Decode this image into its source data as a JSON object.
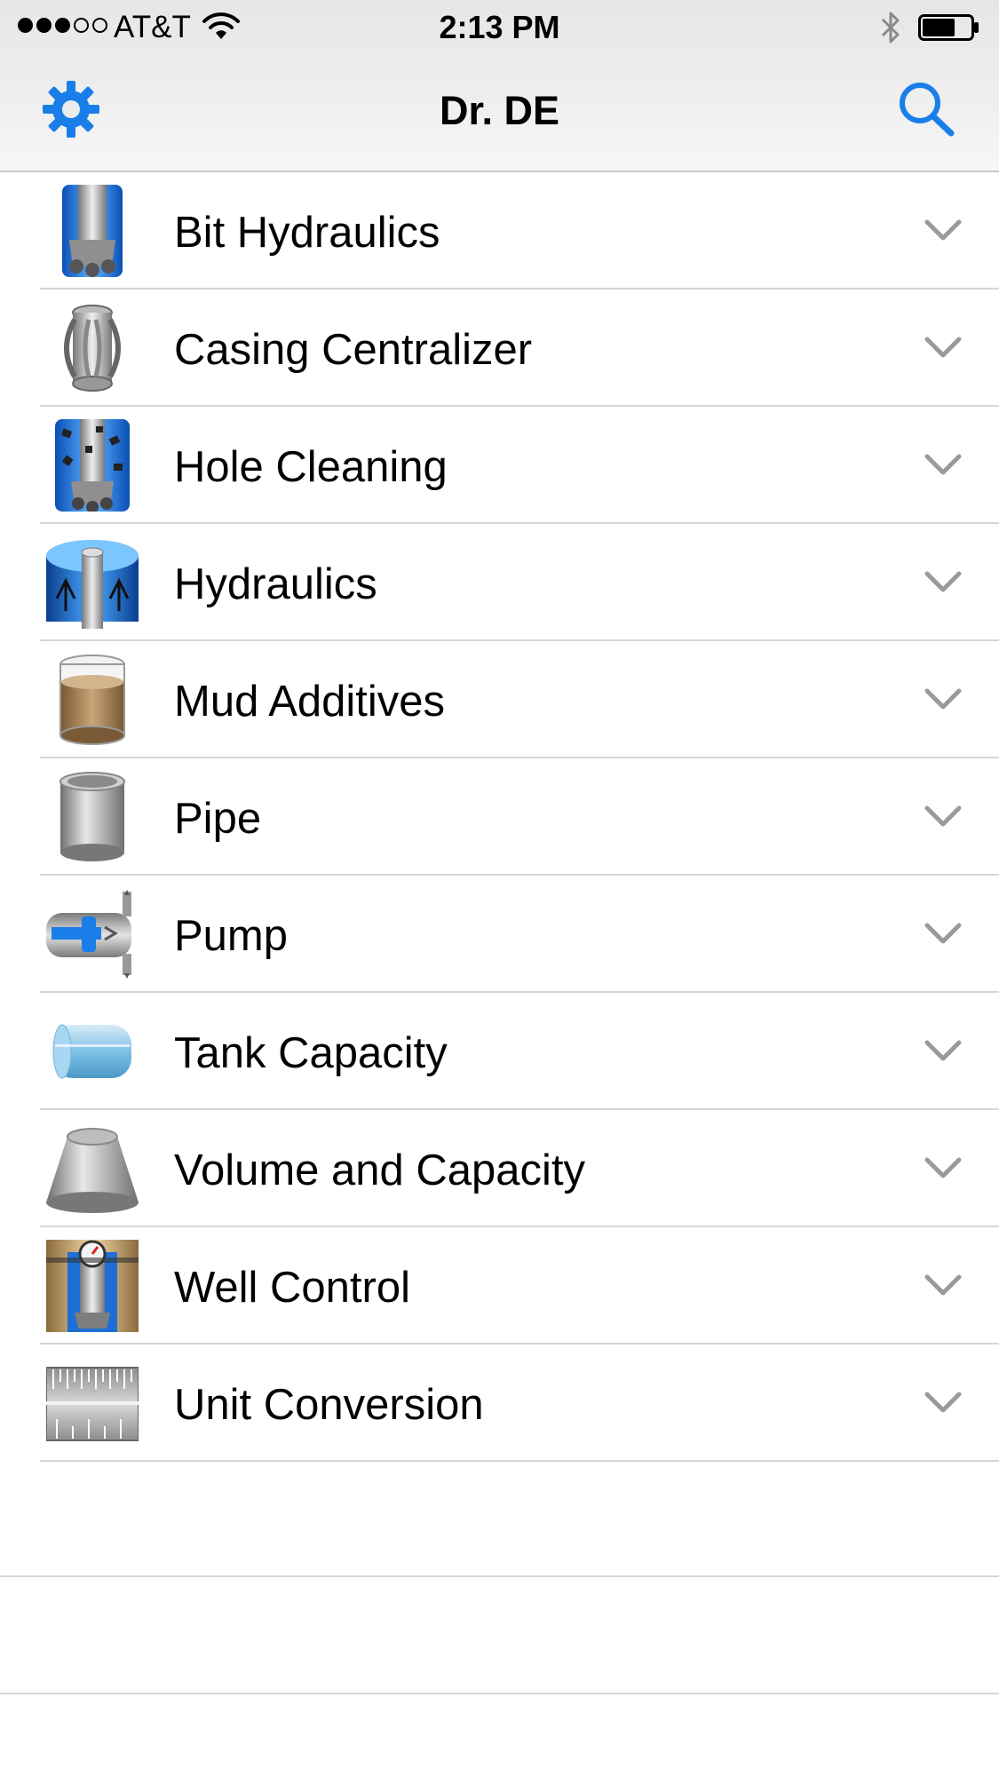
{
  "status_bar": {
    "carrier": "AT&T",
    "time": "2:13 PM",
    "signal_bars_filled": 3,
    "signal_bars_total": 5,
    "battery_level": 0.5
  },
  "nav": {
    "title": "Dr. DE",
    "left_icon": "gear-icon",
    "right_icon": "search-icon",
    "accent_color": "#1a7ee8"
  },
  "list": {
    "items": [
      {
        "label": "Bit Hydraulics",
        "icon": "bit-hydraulics-icon"
      },
      {
        "label": "Casing Centralizer",
        "icon": "casing-centralizer-icon"
      },
      {
        "label": "Hole Cleaning",
        "icon": "hole-cleaning-icon"
      },
      {
        "label": "Hydraulics",
        "icon": "hydraulics-icon"
      },
      {
        "label": "Mud Additives",
        "icon": "mud-additives-icon"
      },
      {
        "label": "Pipe",
        "icon": "pipe-icon"
      },
      {
        "label": "Pump",
        "icon": "pump-icon"
      },
      {
        "label": "Tank Capacity",
        "icon": "tank-capacity-icon"
      },
      {
        "label": "Volume and Capacity",
        "icon": "volume-capacity-icon"
      },
      {
        "label": "Well Control",
        "icon": "well-control-icon"
      },
      {
        "label": "Unit Conversion",
        "icon": "unit-conversion-icon"
      }
    ]
  }
}
